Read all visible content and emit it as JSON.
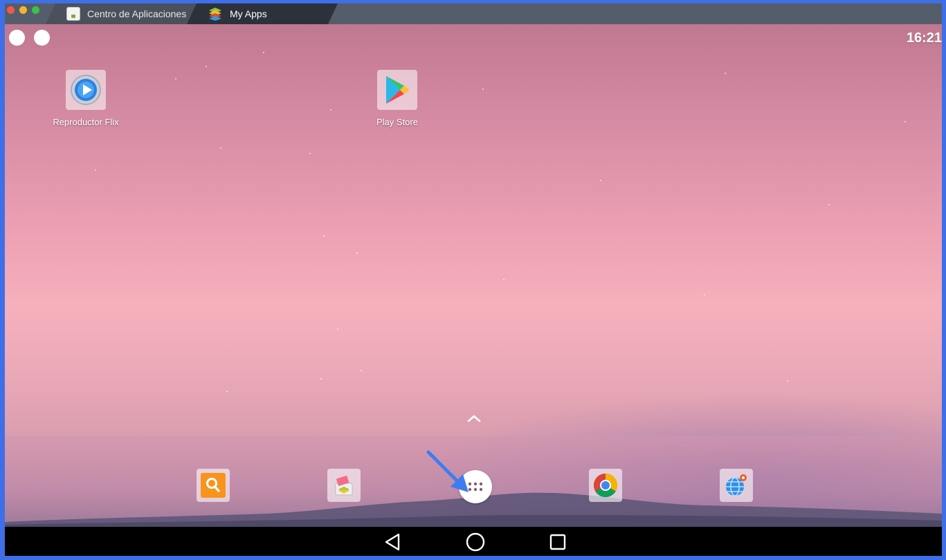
{
  "window": {
    "tabs": [
      {
        "label": "Centro de Aplicaciones",
        "icon": "app-center-icon",
        "active": false
      },
      {
        "label": "My Apps",
        "icon": "bluestacks-icon",
        "active": true
      }
    ]
  },
  "status_bar": {
    "time": "16:21",
    "notification_icons": [
      "circle-icon",
      "circle-icon"
    ]
  },
  "desktop": {
    "apps": [
      {
        "label": "Reproductor Flix",
        "icon": "play-circle-icon"
      },
      {
        "label": "Play Store",
        "icon": "play-store-icon"
      }
    ]
  },
  "dock": {
    "items": [
      {
        "icon": "search-icon",
        "color": "#f7941d"
      },
      {
        "icon": "gift-box-icon"
      },
      {
        "icon": "app-drawer-icon"
      },
      {
        "icon": "chrome-icon"
      },
      {
        "icon": "browser-globe-icon"
      }
    ]
  },
  "navigation": {
    "buttons": [
      "back-icon",
      "home-icon",
      "recents-icon"
    ]
  },
  "colors": {
    "frame": "#3f6fe6",
    "titlebar": "#565d6a",
    "active_tab": "#2c313c",
    "annotation_arrow": "#3c7df0"
  }
}
